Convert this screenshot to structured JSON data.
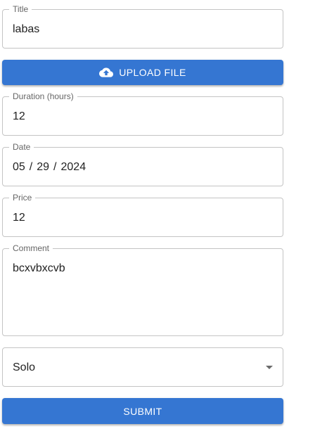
{
  "form": {
    "title_field": {
      "label": "Title",
      "value": "labas"
    },
    "upload_button": {
      "label": "UPLOAD FILE",
      "icon": "cloud-upload-icon"
    },
    "duration_field": {
      "label": "Duration (hours)",
      "value": "12"
    },
    "date_field": {
      "label": "Date",
      "month": "05",
      "day": "29",
      "year": "2024",
      "separator": "/"
    },
    "price_field": {
      "label": "Price",
      "value": "12"
    },
    "comment_field": {
      "label": "Comment",
      "value": "bcxvbxcvb"
    },
    "type_select": {
      "value": "Solo",
      "icon": "chevron-down-icon"
    },
    "submit_button": {
      "label": "SUBMIT"
    },
    "colors": {
      "primary": "#3576d2",
      "border": "#c4c4c4",
      "label": "#666666"
    }
  }
}
